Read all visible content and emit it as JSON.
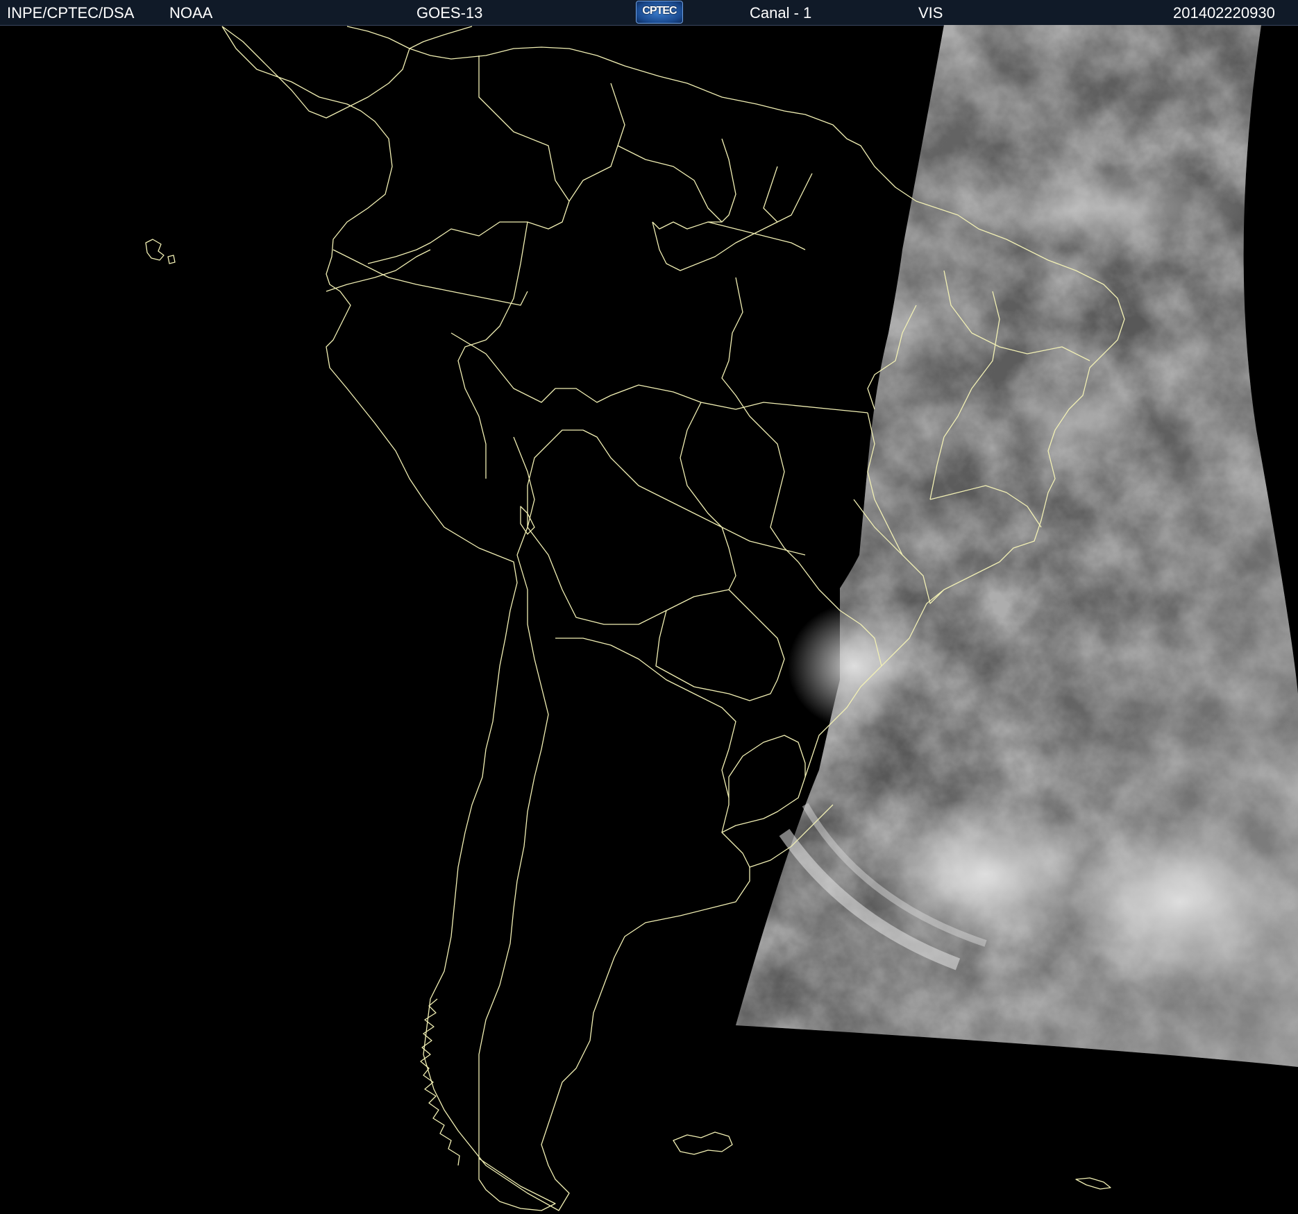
{
  "header": {
    "agency": "INPE/CPTEC/DSA",
    "provider": "NOAA",
    "satellite": "GOES-13",
    "logo_text": "CPTEC",
    "channel": "Canal - 1",
    "band": "VIS",
    "timestamp": "201402220930"
  },
  "colors": {
    "header_bg": "#101a28",
    "background": "#000000",
    "border_lines": "#f2f0b4",
    "cloud_gray": "#6c6c6c"
  }
}
